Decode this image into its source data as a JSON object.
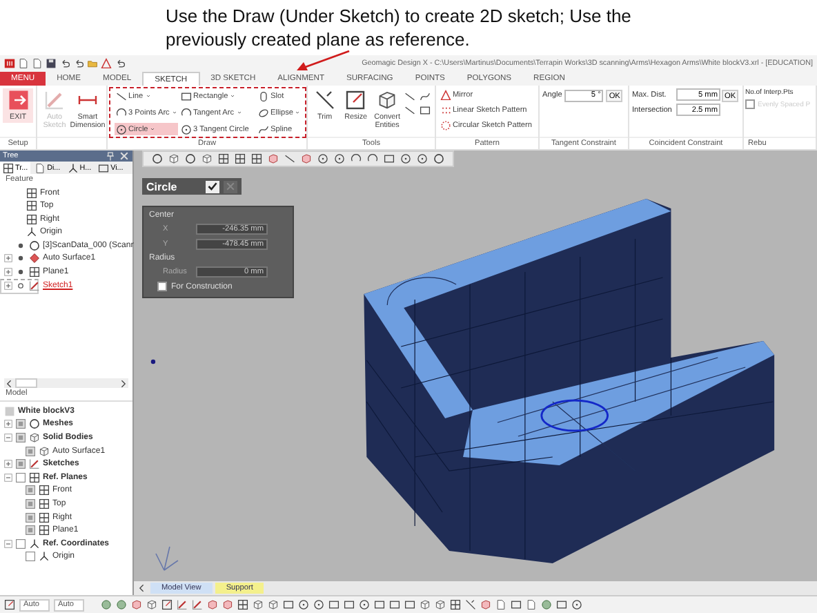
{
  "annotation": {
    "text": "Use the Draw (Under Sketch) to create 2D sketch; Use the previously created plane as reference."
  },
  "window": {
    "title": "Geomagic Design X - C:\\Users\\Martinus\\Documents\\Terrapin Works\\3D scanning\\Arms\\Hexagon Arms\\White blockV3.xrl - [EDUCATION]"
  },
  "tabs": [
    {
      "label": "MENU",
      "kind": "menu",
      "selected": false
    },
    {
      "label": "HOME",
      "kind": "tab",
      "selected": false
    },
    {
      "label": "MODEL",
      "kind": "tab",
      "selected": false
    },
    {
      "label": "SKETCH",
      "kind": "tab",
      "selected": true
    },
    {
      "label": "3D SKETCH",
      "kind": "tab",
      "selected": false
    },
    {
      "label": "ALIGNMENT",
      "kind": "tab",
      "selected": false
    },
    {
      "label": "SURFACING",
      "kind": "tab",
      "selected": false
    },
    {
      "label": "POINTS",
      "kind": "tab",
      "selected": false
    },
    {
      "label": "POLYGONS",
      "kind": "tab",
      "selected": false
    },
    {
      "label": "REGION",
      "kind": "tab",
      "selected": false
    }
  ],
  "ribbon": {
    "setup": {
      "label": "Setup",
      "button": "EXIT"
    },
    "dimension_buttons": [
      {
        "label": "Auto Sketch",
        "disabled": true
      },
      {
        "label": "Smart Dimension",
        "disabled": false
      }
    ],
    "draw": {
      "label": "Draw",
      "items": [
        {
          "label": "Line",
          "dropdown": true,
          "selected": false
        },
        {
          "label": "Rectangle",
          "dropdown": true,
          "selected": false
        },
        {
          "label": "Slot",
          "dropdown": false,
          "selected": false
        },
        {
          "label": "3 Points Arc",
          "dropdown": true,
          "selected": false
        },
        {
          "label": "Tangent Arc",
          "dropdown": true,
          "selected": false
        },
        {
          "label": "Ellipse",
          "dropdown": true,
          "selected": false
        },
        {
          "label": "Circle",
          "dropdown": true,
          "selected": true
        },
        {
          "label": "3 Tangent Circle",
          "dropdown": false,
          "selected": false
        },
        {
          "label": "Spline",
          "dropdown": false,
          "selected": false
        }
      ]
    },
    "tools": {
      "label": "Tools",
      "buttons": [
        "Trim",
        "Resize",
        "Convert Entities"
      ]
    },
    "pattern": {
      "label": "Pattern",
      "items": [
        "Mirror",
        "Linear Sketch Pattern",
        "Circular Sketch Pattern"
      ]
    },
    "tangent_constraint": {
      "label": "Tangent Constraint",
      "field_label": "Angle",
      "value": "5 °",
      "button": "OK"
    },
    "coincident_constraint": {
      "label": "Coincident Constraint",
      "fields": [
        {
          "label": "Max. Dist.",
          "value": "5 mm"
        },
        {
          "label": "Intersection",
          "value": "2.5 mm"
        }
      ],
      "button": "OK"
    },
    "rebuild": {
      "label": "Rebu",
      "field_label": "No.of Interp.Pts",
      "checkbox": {
        "label": "Evenly Spaced P",
        "checked": false,
        "disabled": true
      }
    }
  },
  "tree": {
    "title": "Tree",
    "tabs": [
      {
        "label": "Tr...",
        "selected": true
      },
      {
        "label": "Di...",
        "selected": false
      },
      {
        "label": "H...",
        "selected": false
      },
      {
        "label": "Vi...",
        "selected": false
      }
    ],
    "feature_header": "Feature",
    "features": [
      {
        "label": "Front",
        "selected": false
      },
      {
        "label": "Top",
        "selected": false
      },
      {
        "label": "Right",
        "selected": false
      },
      {
        "label": "Origin",
        "selected": false
      },
      {
        "label": "[3]ScanData_000 (Scann",
        "selected": false,
        "visible": true
      },
      {
        "label": "Auto Surface1",
        "selected": false,
        "visible": true,
        "expanded": false
      },
      {
        "label": "Plane1",
        "selected": false,
        "visible": true,
        "expanded": false
      },
      {
        "label": "Sketch1",
        "selected": true,
        "visible": false,
        "expanded": false
      }
    ],
    "model_header": "Model",
    "model": {
      "label": "White blockV3",
      "children": [
        {
          "label": "Meshes",
          "visible": true,
          "expanded": false
        },
        {
          "label": "Solid Bodies",
          "visible": true,
          "expanded": true,
          "children": [
            {
              "label": "Auto Surface1",
              "visible": true
            }
          ]
        },
        {
          "label": "Sketches",
          "visible": true,
          "expanded": false
        },
        {
          "label": "Ref. Planes",
          "visible": false,
          "expanded": true,
          "children": [
            {
              "label": "Front",
              "visible": true
            },
            {
              "label": "Top",
              "visible": true
            },
            {
              "label": "Right",
              "visible": true
            },
            {
              "label": "Plane1",
              "visible": true
            }
          ]
        },
        {
          "label": "Ref. Coordinates",
          "visible": false,
          "expanded": true,
          "children": [
            {
              "label": "Origin",
              "visible": false
            }
          ]
        }
      ]
    }
  },
  "viewport": {
    "dialog": {
      "title": "Circle",
      "sections": [
        {
          "label": "Center",
          "fields": [
            {
              "label": "X",
              "value": "-246.35 mm"
            },
            {
              "label": "Y",
              "value": "-478.45 mm"
            }
          ]
        },
        {
          "label": "Radius",
          "fields": [
            {
              "label": "Radius",
              "value": "0 mm"
            }
          ]
        }
      ],
      "checkbox": {
        "label": "For Construction",
        "checked": false
      }
    },
    "tabs": [
      {
        "label": "Model View",
        "color": "#cfe0f5"
      },
      {
        "label": "Support",
        "color": "#f4f08c"
      }
    ]
  },
  "status_bar": {
    "selects": [
      {
        "value": "Auto"
      },
      {
        "value": "Auto"
      }
    ]
  }
}
